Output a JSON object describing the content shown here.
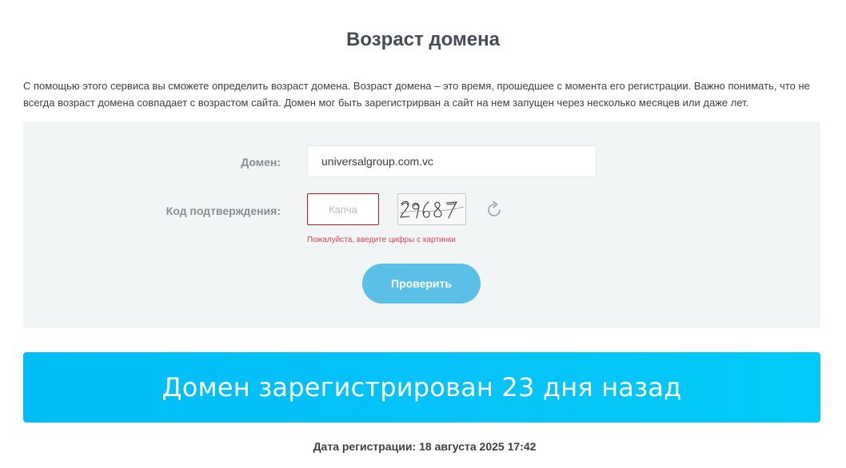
{
  "page": {
    "title": "Возраст домена",
    "intro": "С помощью этого сервиса вы сможете определить возраст домена. Возраст домена – это время, прошедшее с момента его регистрации. Важно понимать, что не всегда возраст домена совпадает с возрастом сайта. Домен мог быть зарегистрирван а сайт на нем запущен через несколько месяцев или даже лет."
  },
  "form": {
    "domain_label": "Домен:",
    "domain_value": "universalgroup.com.vc",
    "captcha_label": "Код подтверждения:",
    "captcha_placeholder": "Капча",
    "captcha_code": "29687",
    "captcha_error": "Пожалуйста, введите цифры с картинки",
    "submit_label": "Проверить",
    "refresh_icon": "refresh-icon"
  },
  "result": {
    "message": "Домен зарегистрирован 23 дня назад",
    "reg_date_label": "Дата регистрации:",
    "reg_date_value": "18 августа 2025 17:42"
  },
  "colors": {
    "banner": "#00c2f7",
    "button": "#5bc0e8",
    "error": "#e0484f",
    "panel": "#f2f5f6"
  }
}
